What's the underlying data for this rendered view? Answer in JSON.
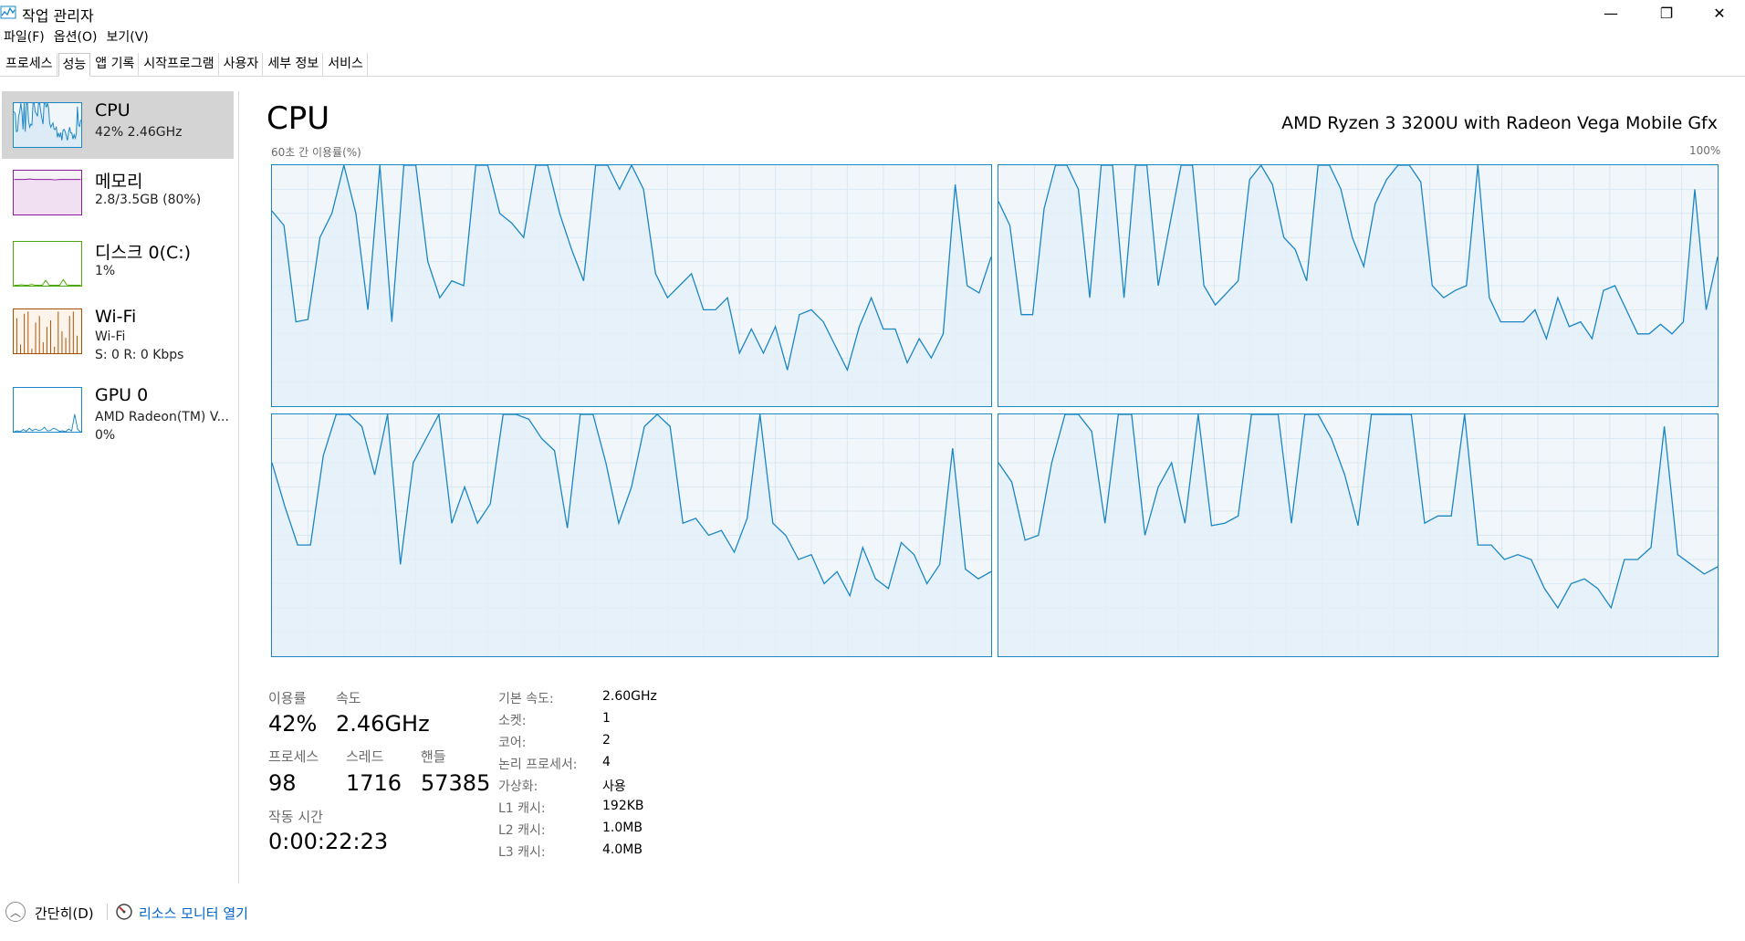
{
  "window": {
    "title": "작업 관리자",
    "minimize": "—",
    "maximize": "❐",
    "close": "✕"
  },
  "menu": [
    "파일(F)",
    "옵션(O)",
    "보기(V)"
  ],
  "tabs": [
    "프로세스",
    "성능",
    "앱 기록",
    "시작프로그램",
    "사용자",
    "세부 정보",
    "서비스"
  ],
  "active_tab": "성능",
  "resources": [
    {
      "name": "CPU",
      "sub1": "42% 2.46GHz",
      "sub2": "",
      "color": "#1a86c5"
    },
    {
      "name": "메모리",
      "sub1": "2.8/3.5GB (80%)",
      "sub2": "",
      "color": "#8b1a9b"
    },
    {
      "name": "디스크 0(C:)",
      "sub1": "1%",
      "sub2": "",
      "color": "#4da60c"
    },
    {
      "name": "Wi-Fi",
      "sub1": "Wi-Fi",
      "sub2": "S: 0 R: 0 Kbps",
      "color": "#a74f01"
    },
    {
      "name": "GPU 0",
      "sub1": "AMD Radeon(TM) V...",
      "sub2": "0%",
      "color": "#1a86c5"
    }
  ],
  "main": {
    "title": "CPU",
    "model": "AMD Ryzen 3 3200U with Radeon Vega Mobile Gfx",
    "axis_left": "60초 간 이용률(%)",
    "axis_right": "100%"
  },
  "stats": {
    "usage_label": "이용률",
    "usage_value": "42%",
    "speed_label": "속도",
    "speed_value": "2.46GHz",
    "processes_label": "프로세스",
    "processes_value": "98",
    "threads_label": "스레드",
    "threads_value": "1716",
    "handles_label": "핸들",
    "handles_value": "57385",
    "uptime_label": "작동 시간",
    "uptime_value": "0:00:22:23"
  },
  "info": [
    {
      "label": "기본 속도:",
      "value": "2.60GHz"
    },
    {
      "label": "소켓:",
      "value": "1"
    },
    {
      "label": "코어:",
      "value": "2"
    },
    {
      "label": "논리 프로세서:",
      "value": "4"
    },
    {
      "label": "가상화:",
      "value": "사용"
    },
    {
      "label": "L1 캐시:",
      "value": "192KB"
    },
    {
      "label": "L2 캐시:",
      "value": "1.0MB"
    },
    {
      "label": "L3 캐시:",
      "value": "4.0MB"
    }
  ],
  "bottom": {
    "fewer_details": "간단히(D)",
    "open_resmon": "리소스 모니터 열기"
  },
  "chart_data": {
    "type": "line",
    "title": "",
    "xlabel": "60초 간 이용률(%)",
    "ylabel": "",
    "ylim": [
      0,
      100
    ],
    "series": [
      {
        "values": [
          81,
          75,
          35,
          36,
          70,
          80,
          100,
          80,
          40,
          100,
          35,
          100,
          100,
          60,
          45,
          52,
          50,
          100,
          100,
          80,
          76,
          70,
          100,
          100,
          80,
          65,
          52,
          100,
          100,
          90,
          100,
          90,
          55,
          45,
          50,
          55,
          40,
          40,
          45,
          22,
          32,
          22,
          33,
          15,
          38,
          40,
          35,
          25,
          15,
          33,
          45,
          32,
          32,
          18,
          28,
          20,
          30,
          92,
          50,
          47,
          62
        ]
      },
      {
        "values": [
          85,
          75,
          38,
          38,
          82,
          100,
          100,
          90,
          45,
          100,
          100,
          45,
          100,
          100,
          50,
          75,
          100,
          100,
          50,
          42,
          47,
          52,
          94,
          100,
          92,
          70,
          65,
          52,
          100,
          100,
          90,
          70,
          58,
          84,
          94,
          100,
          100,
          93,
          50,
          45,
          48,
          50,
          100,
          45,
          35,
          35,
          35,
          40,
          28,
          45,
          33,
          35,
          28,
          48,
          50,
          40,
          30,
          30,
          34,
          30,
          35,
          90,
          40,
          62
        ]
      },
      {
        "values": [
          80,
          62,
          46,
          46,
          83,
          100,
          100,
          95,
          75,
          100,
          38,
          80,
          90,
          100,
          55,
          70,
          55,
          63,
          100,
          100,
          98,
          90,
          85,
          53,
          100,
          100,
          80,
          55,
          70,
          95,
          100,
          95,
          55,
          57,
          50,
          52,
          43,
          57,
          100,
          55,
          50,
          40,
          42,
          30,
          35,
          25,
          45,
          32,
          28,
          47,
          42,
          30,
          38,
          86,
          36,
          32,
          35
        ]
      },
      {
        "values": [
          80,
          72,
          48,
          50,
          80,
          100,
          100,
          93,
          55,
          100,
          100,
          50,
          70,
          80,
          55,
          100,
          54,
          55,
          58,
          100,
          100,
          100,
          55,
          100,
          100,
          90,
          75,
          54,
          100,
          100,
          100,
          100,
          55,
          58,
          58,
          100,
          46,
          46,
          40,
          42,
          40,
          28,
          20,
          30,
          32,
          28,
          20,
          40,
          40,
          45,
          95,
          42,
          38,
          34,
          37
        ]
      }
    ]
  }
}
